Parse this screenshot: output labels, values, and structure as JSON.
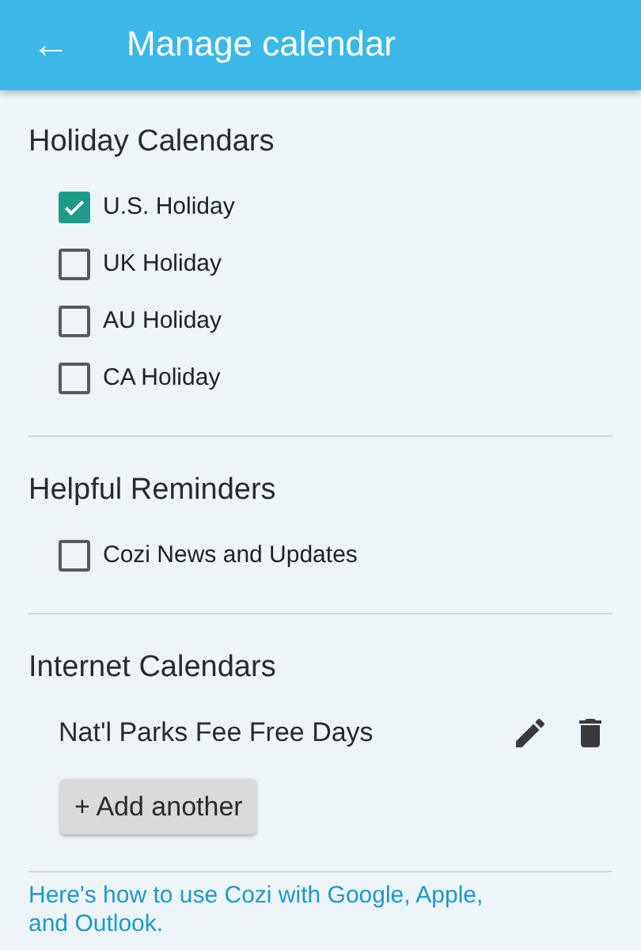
{
  "app_bar": {
    "back": "←",
    "title": "Manage calendar"
  },
  "sections": [
    {
      "title": "Holiday Calendars",
      "items": [
        {
          "kind": "checkbox",
          "label": "U.S. Holiday",
          "checked": true
        },
        {
          "kind": "checkbox",
          "label": "UK Holiday",
          "checked": false
        },
        {
          "kind": "checkbox",
          "label": "AU Holiday",
          "checked": false
        },
        {
          "kind": "checkbox",
          "label": "CA Holiday",
          "checked": false
        }
      ]
    },
    {
      "title": "Helpful Reminders",
      "items": [
        {
          "kind": "checkbox",
          "label": "Cozi News and Updates",
          "checked": false
        }
      ]
    },
    {
      "title": "Internet Calendars",
      "items": [
        {
          "kind": "calendar",
          "label": "Nat'l Parks Fee Free Days"
        }
      ],
      "add_button": "+ Add another"
    }
  ],
  "help_link": "Here's how to use Cozi with Google, Apple, and Outlook."
}
